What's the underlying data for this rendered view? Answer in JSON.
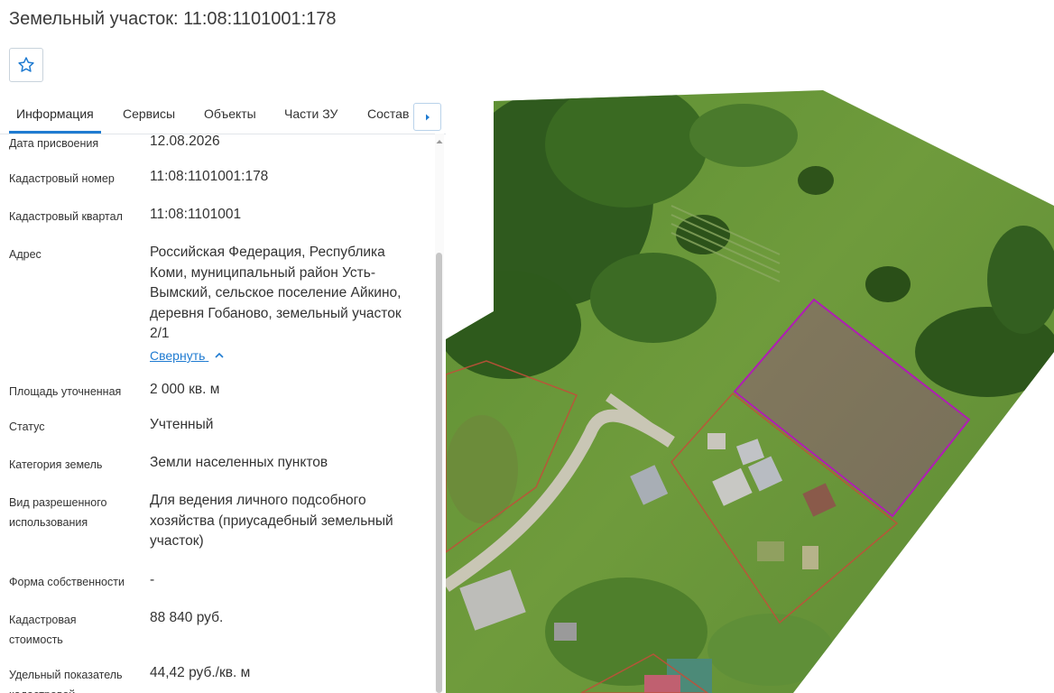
{
  "header": {
    "title": "Земельный участок: 11:08:1101001:178",
    "favorite_icon": "star-icon"
  },
  "tabs": [
    {
      "label": "Информация",
      "active": true
    },
    {
      "label": "Сервисы",
      "active": false
    },
    {
      "label": "Объекты",
      "active": false
    },
    {
      "label": "Части ЗУ",
      "active": false
    },
    {
      "label": "Состав",
      "active": false
    }
  ],
  "tabs_next_icon": "chevron-right-icon",
  "fields": [
    {
      "label": "Дата присвоения",
      "value": "12.08.2026"
    },
    {
      "label": "Кадастровый номер",
      "value": "11:08:1101001:178"
    },
    {
      "label": "Кадастровый квартал",
      "value": "11:08:1101001"
    },
    {
      "label": "Адрес",
      "value": "Российская Федерация, Республика Коми, муниципальный район Усть-Вымский, сельское поселение Айкино, деревня Гобаново, земельный участок 2/1",
      "link": "Свернуть"
    },
    {
      "label": "Площадь уточненная",
      "value": "2 000 кв. м"
    },
    {
      "label": "Статус",
      "value": "Учтенный"
    },
    {
      "label": "Категория земель",
      "value": "Земли населенных пунктов"
    },
    {
      "label": "Вид разрешенного использования",
      "value": "Для ведения личного подсобного хозяйства (приусадебный земельный участок)"
    },
    {
      "label": "Форма собственности",
      "value": "-"
    },
    {
      "label": "Кадастровая стоимость",
      "value": "88 840 руб."
    },
    {
      "label": "Удельный показатель кадастровой",
      "value": "44,42 руб./кв. м"
    }
  ],
  "colors": {
    "accent": "#1f7bd1",
    "selected_parcel": "#b01cb5",
    "neighbor_parcel": "#c0503a"
  }
}
